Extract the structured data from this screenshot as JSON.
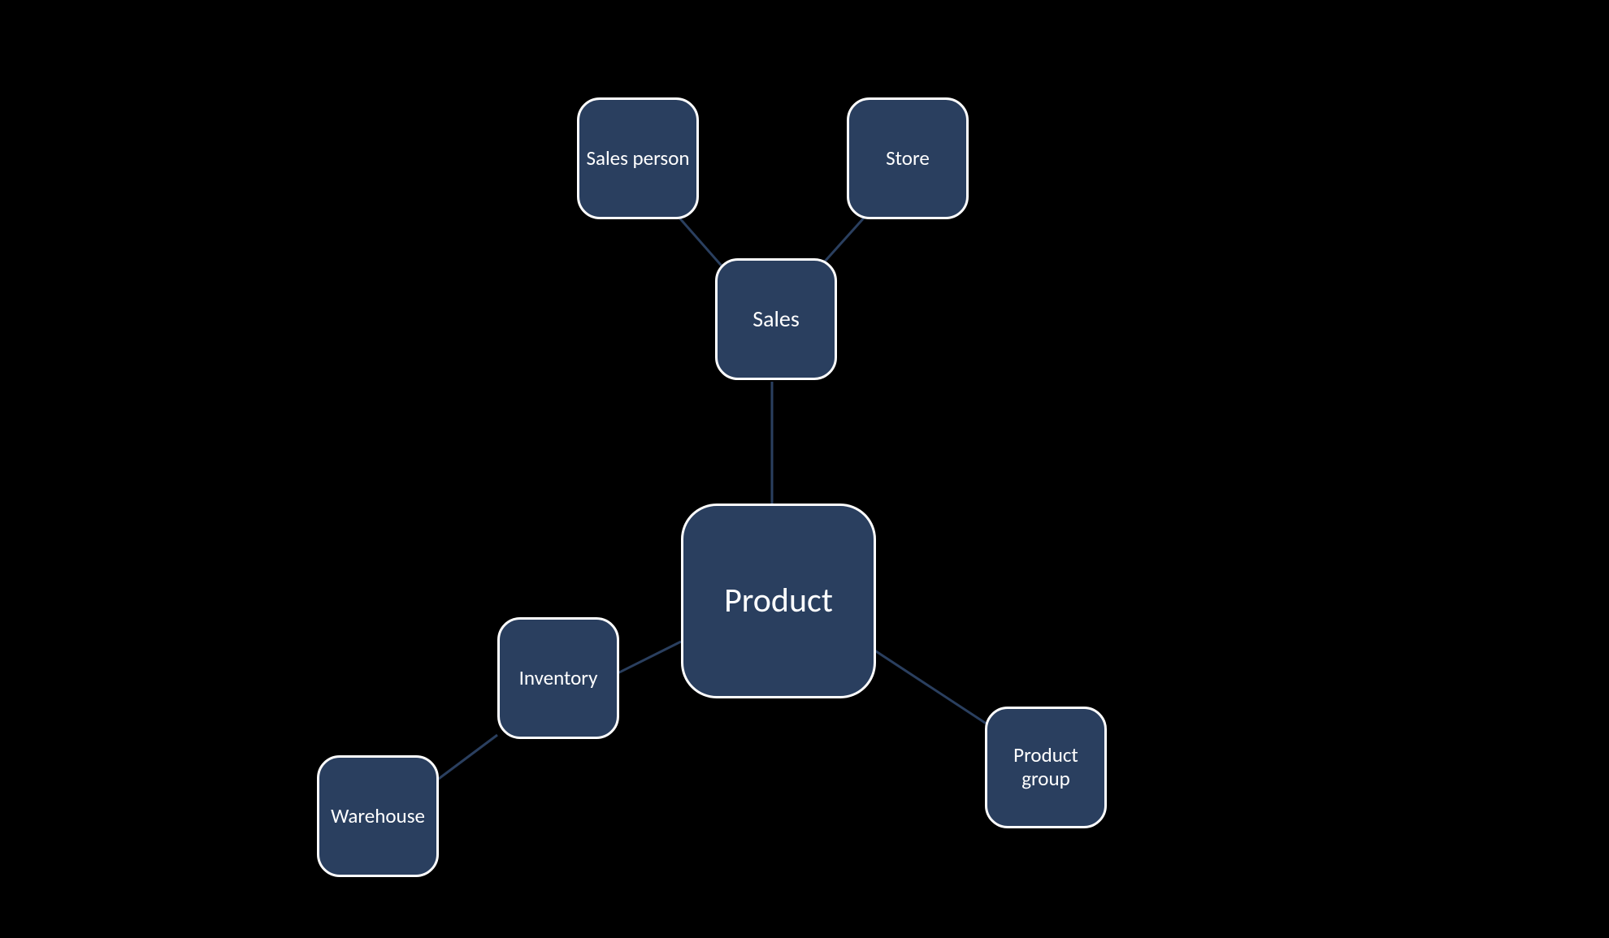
{
  "diagram": {
    "nodes": {
      "product": {
        "label": "Product"
      },
      "sales": {
        "label": "Sales"
      },
      "sales_person": {
        "label": "Sales person"
      },
      "store": {
        "label": "Store"
      },
      "inventory": {
        "label": "Inventory"
      },
      "warehouse": {
        "label": "Warehouse"
      },
      "product_group": {
        "label": "Product group"
      }
    },
    "edges": [
      {
        "from": "product",
        "to": "sales"
      },
      {
        "from": "sales",
        "to": "sales_person"
      },
      {
        "from": "sales",
        "to": "store"
      },
      {
        "from": "product",
        "to": "inventory"
      },
      {
        "from": "inventory",
        "to": "warehouse"
      },
      {
        "from": "product",
        "to": "product_group"
      }
    ],
    "colors": {
      "node_fill": "#2a3f5f",
      "node_border": "#ffffff",
      "background": "#000000",
      "connector": "#2a3f5f"
    }
  }
}
